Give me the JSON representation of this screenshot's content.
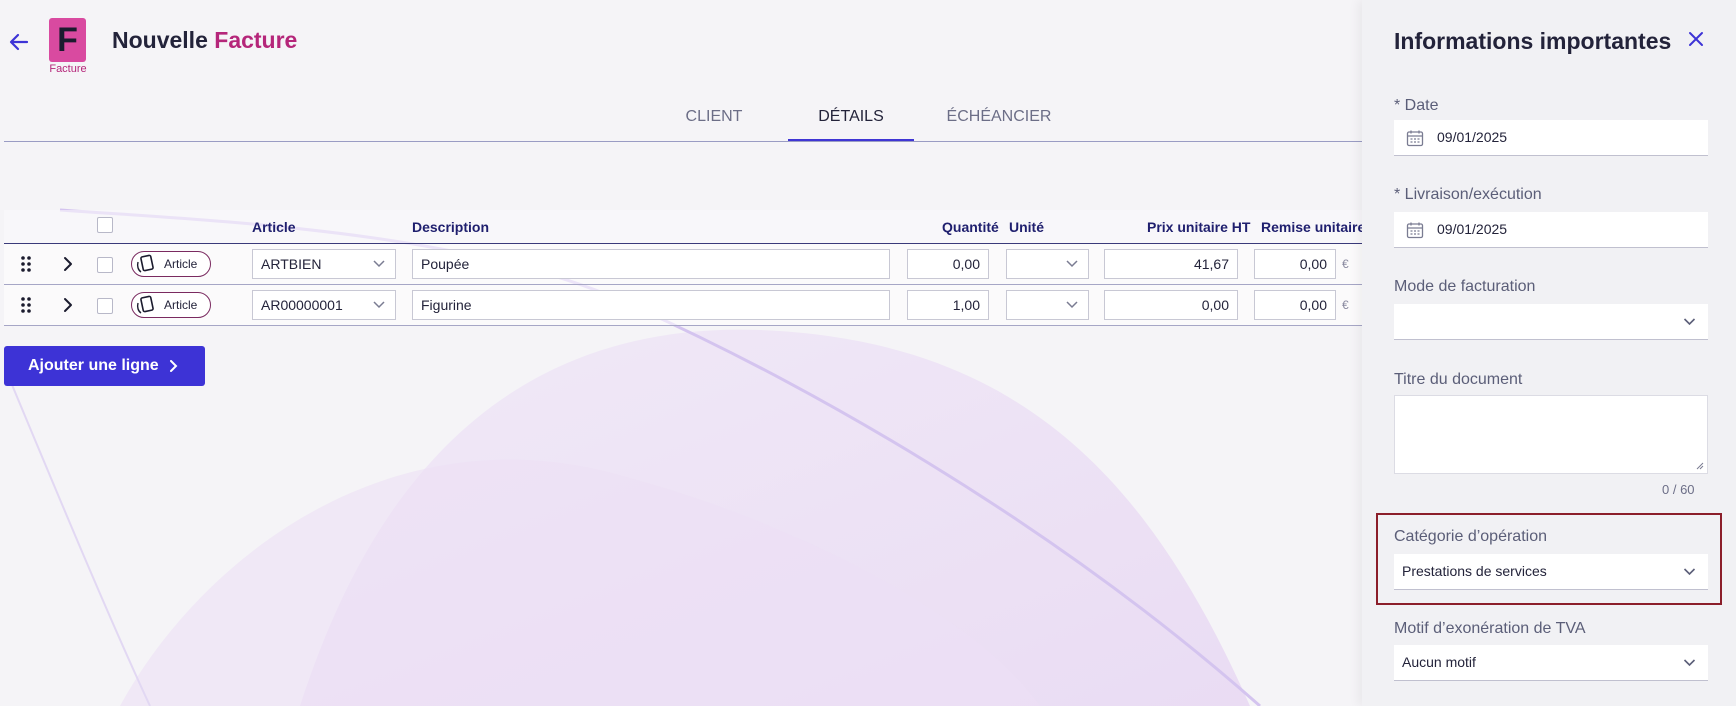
{
  "header": {
    "logo_letter": "F",
    "logo_caption": "Facture",
    "title_prefix": "Nouvelle",
    "title_accent": "Facture"
  },
  "tabs": [
    {
      "label": "CLIENT",
      "active": false
    },
    {
      "label": "DÉTAILS",
      "active": true
    },
    {
      "label": "ÉCHÉANCIER",
      "active": false
    }
  ],
  "table": {
    "columns": {
      "article": "Article",
      "description": "Description",
      "quantite": "Quantité",
      "unite": "Unité",
      "prix": "Prix unitaire HT",
      "remise": "Remise unitaire"
    },
    "rows": [
      {
        "type": "Article",
        "article": "ARTBIEN",
        "description": "Poupée",
        "quantite": "0,00",
        "unite": "",
        "prix": "41,67",
        "remise": "0,00",
        "currency": "€"
      },
      {
        "type": "Article",
        "article": "AR00000001",
        "description": "Figurine",
        "quantite": "1,00",
        "unite": "",
        "prix": "0,00",
        "remise": "0,00",
        "currency": "€"
      }
    ]
  },
  "add_line_button": "Ajouter une ligne",
  "panel": {
    "title": "Informations importantes",
    "date_label": "* Date",
    "date_value": "09/01/2025",
    "livraison_label": "* Livraison/exécution",
    "livraison_value": "09/01/2025",
    "mode_label": "Mode de facturation",
    "mode_value": "",
    "titre_label": "Titre du document",
    "titre_value": "",
    "titre_counter": "0 / 60",
    "categorie_label": "Catégorie d’opération",
    "categorie_value": "Prestations de services",
    "motif_label": "Motif d’exonération de TVA",
    "motif_value": "Aucun motif"
  },
  "colors": {
    "accent": "#3d33d6",
    "brand": "#b5267a",
    "logo_bg": "#d94aa0",
    "highlight": "#8b1e2a"
  }
}
